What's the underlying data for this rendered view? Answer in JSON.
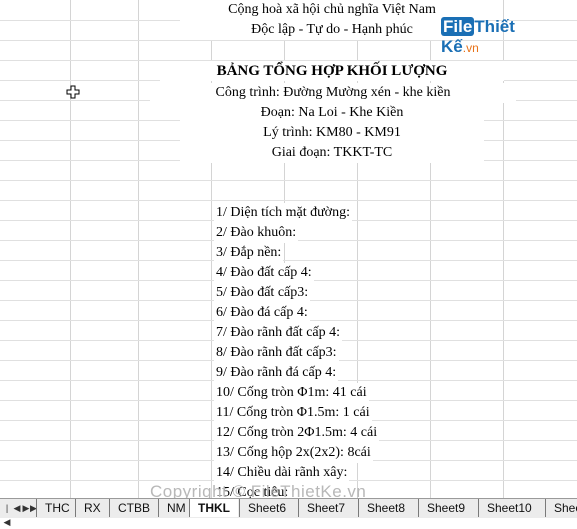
{
  "header": {
    "line1": "Cộng hoà xã hội chủ nghĩa Việt Nam",
    "line2": "Độc lập - Tự do - Hạnh phúc",
    "title": "BẢNG TỔNG HỢP KHỐI LƯỢNG",
    "cong_trinh": "Công trình: Đường Mường xén - khe kiền",
    "doan": "Đoạn: Na Loi - Khe Kiền",
    "ly_trinh": "Lý trình: KM80 - KM91",
    "giai_doan": "Giai đoạn: TKKT-TC"
  },
  "items": [
    "1/ Diện tích mặt đường:",
    "2/ Đào khuôn:",
    "3/ Đắp nền:",
    "4/ Đào đất cấp 4:",
    "5/ Đào đất cấp3:",
    "6/ Đào đá cấp 4:",
    "7/ Đào rãnh đất cấp 4:",
    "8/ Đào rãnh đất cấp3:",
    "9/ Đào rãnh đá cấp 4:",
    "10/ Cống tròn Φ1m: 41 cái",
    "11/ Cống tròn Φ1.5m: 1 cái",
    "12/ Cống tròn 2Φ1.5m: 4 cái",
    "13/ Cống hộp 2x(2x2): 8cái",
    "14/ Chiều dài rãnh xây:",
    "15/ Cọc tiêu:"
  ],
  "logo_text": {
    "part1": "File",
    "part2": "Thiết Kế",
    "part3": ".vn"
  },
  "watermark": "Copyright © FileThietKe.vn",
  "tabs": [
    {
      "label": "THC",
      "active": false
    },
    {
      "label": "RX",
      "active": false
    },
    {
      "label": "CTBB",
      "active": false
    },
    {
      "label": "NM",
      "active": false
    },
    {
      "label": "THKL",
      "active": true
    },
    {
      "label": "Sheet6",
      "active": false
    },
    {
      "label": "Sheet7",
      "active": false
    },
    {
      "label": "Sheet8",
      "active": false
    },
    {
      "label": "Sheet9",
      "active": false
    },
    {
      "label": "Sheet10",
      "active": false
    },
    {
      "label": "Shee",
      "active": false
    }
  ],
  "colors": {
    "logo_blue": "#1a6fb5",
    "logo_orange": "#e8731a",
    "grid": "#d4d4d4",
    "active_tab": "#ffffff"
  }
}
